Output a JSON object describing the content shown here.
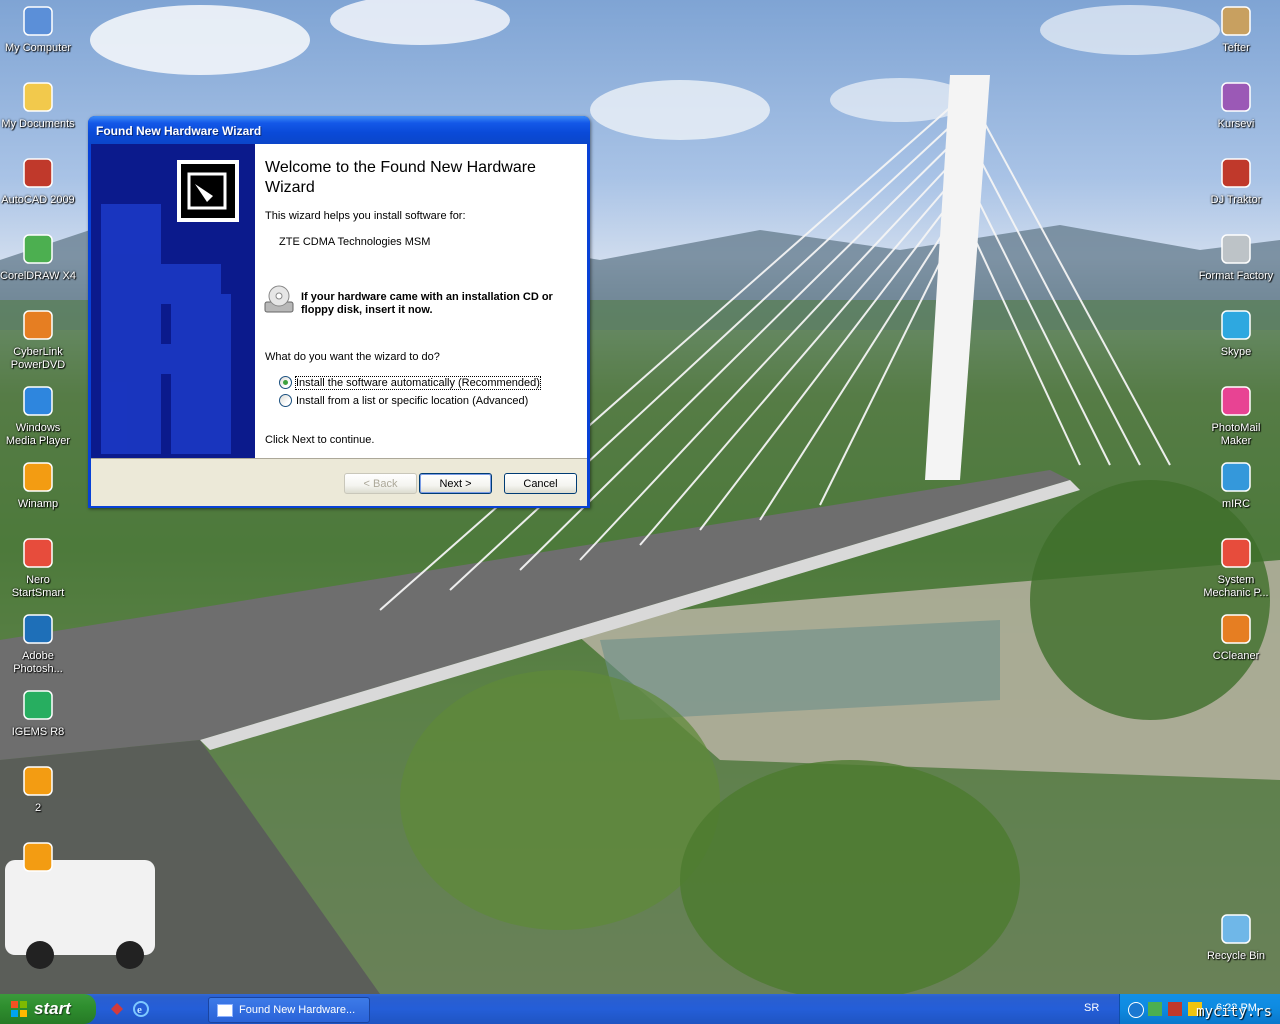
{
  "desktop": {
    "left_icons": [
      {
        "label": "My Computer",
        "icon": "computer-icon",
        "color": "#5b8fd8"
      },
      {
        "label": "My Documents",
        "icon": "folder-icon",
        "color": "#f2c94c"
      },
      {
        "label": "AutoCAD 2009",
        "icon": "autocad-icon",
        "color": "#c0392b"
      },
      {
        "label": "CorelDRAW X4",
        "icon": "coreldraw-icon",
        "color": "#4caf50"
      },
      {
        "label": "CyberLink PowerDVD",
        "icon": "dvd-icon",
        "color": "#e67e22"
      },
      {
        "label": "Windows Media Player",
        "icon": "media-player-icon",
        "color": "#2e86de"
      },
      {
        "label": "Winamp",
        "icon": "winamp-icon",
        "color": "#f39c12"
      },
      {
        "label": "Nero StartSmart",
        "icon": "nero-icon",
        "color": "#e74c3c"
      },
      {
        "label": "Adobe Photosh...",
        "icon": "photoshop-icon",
        "color": "#1e6fb8"
      },
      {
        "label": "IGEMS R8",
        "icon": "igems-icon",
        "color": "#27ae60"
      },
      {
        "label": "2",
        "icon": "jpg-file-icon",
        "color": "#f39c12"
      },
      {
        "label": "",
        "icon": "jpg-file-icon",
        "color": "#f39c12"
      }
    ],
    "right_icons": [
      {
        "label": "Tefter",
        "icon": "pen-icon",
        "color": "#c8a060"
      },
      {
        "label": "Kursevi",
        "icon": "winrar-icon",
        "color": "#9b59b6"
      },
      {
        "label": "DJ Traktor",
        "icon": "traktor-icon",
        "color": "#c0392b"
      },
      {
        "label": "Format Factory",
        "icon": "format-factory-icon",
        "color": "#bdc3c7"
      },
      {
        "label": "Skype",
        "icon": "skype-icon",
        "color": "#2ea8e0"
      },
      {
        "label": "PhotoMail Maker",
        "icon": "photomail-icon",
        "color": "#e84393"
      },
      {
        "label": "mIRC",
        "icon": "mirc-icon",
        "color": "#3498db"
      },
      {
        "label": "System Mechanic P...",
        "icon": "system-mechanic-icon",
        "color": "#e74c3c"
      },
      {
        "label": "CCleaner",
        "icon": "ccleaner-icon",
        "color": "#e67e22"
      },
      {
        "label": "Recycle Bin",
        "icon": "recycle-bin-icon",
        "color": "#6fb7e8"
      }
    ]
  },
  "wizard": {
    "title": "Found New Hardware Wizard",
    "heading": "Welcome to the Found New Hardware Wizard",
    "intro": "This wizard helps you install software for:",
    "device": "ZTE CDMA Technologies MSM",
    "cd_prompt": "If your hardware came with an installation CD or floppy disk, insert it now.",
    "question": "What do you want the wizard to do?",
    "options": [
      {
        "label": "Install the software automatically (Recommended)",
        "checked": true
      },
      {
        "label": "Install from a list or specific location (Advanced)",
        "checked": false
      }
    ],
    "continue_text": "Click Next to continue.",
    "buttons": {
      "back": "< Back",
      "next": "Next >",
      "cancel": "Cancel"
    }
  },
  "taskbar": {
    "start_label": "start",
    "task_label": "Found New Hardware...",
    "language": "SR",
    "clock": "6:22 PM"
  },
  "watermark": "mycity.rs"
}
